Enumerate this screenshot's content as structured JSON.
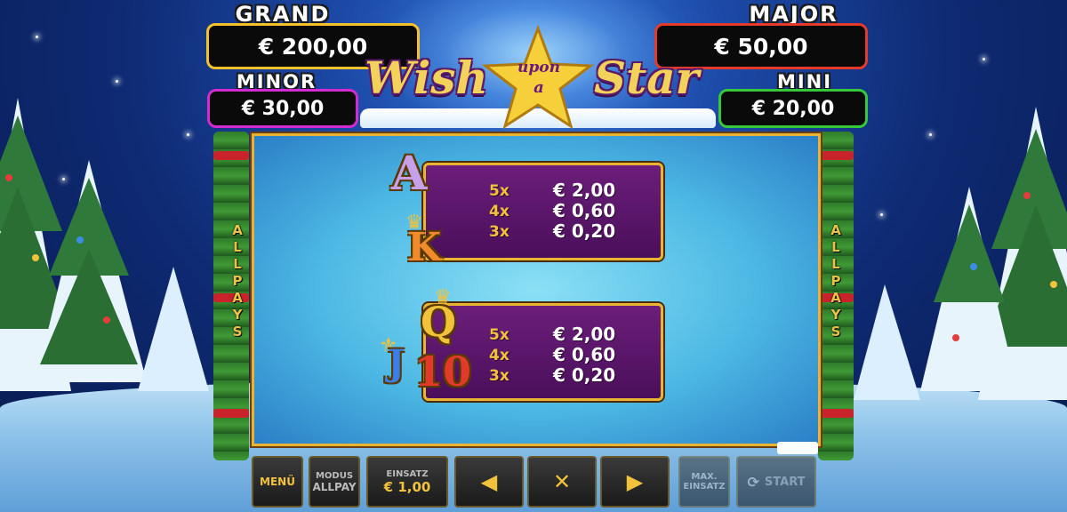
{
  "jackpots": {
    "grand": {
      "label": "GRAND",
      "value": "€ 200,00",
      "color": "#f3c12a"
    },
    "major": {
      "label": "MAJOR",
      "value": "€ 50,00",
      "color": "#e33a2a"
    },
    "minor": {
      "label": "MINOR",
      "value": "€ 30,00",
      "color": "#d22bd0"
    },
    "mini": {
      "label": "MINI",
      "value": "€ 20,00",
      "color": "#36c83a"
    }
  },
  "logo": {
    "word1": "Wish",
    "star_line1": "upon",
    "star_line2": "a",
    "word2": "Star"
  },
  "side_label": "ALLPAYS",
  "paytable": {
    "groups": [
      {
        "symbols": [
          "A",
          "K"
        ],
        "rows": [
          {
            "mult": "5x",
            "value": "€ 2,00"
          },
          {
            "mult": "4x",
            "value": "€ 0,60"
          },
          {
            "mult": "3x",
            "value": "€ 0,20"
          }
        ]
      },
      {
        "symbols": [
          "Q",
          "J",
          "10"
        ],
        "rows": [
          {
            "mult": "5x",
            "value": "€ 2,00"
          },
          {
            "mult": "4x",
            "value": "€ 0,60"
          },
          {
            "mult": "3x",
            "value": "€ 0,20"
          }
        ]
      }
    ]
  },
  "controls": {
    "menu": "MENÜ",
    "mode_label": "MODUS",
    "mode_value": "ALLPAY",
    "bet_label": "EINSATZ",
    "bet_value": "€ 1,00",
    "prev_icon": "arrow-left-icon",
    "close_icon": "close-icon",
    "next_icon": "arrow-right-icon",
    "max_bet_line1": "MAX.",
    "max_bet_line2": "EINSATZ",
    "start": "START"
  },
  "colors": {
    "accent": "#f2c23a",
    "panel_purple": "#6b1e7a",
    "frame_gold": "#e8b431"
  }
}
